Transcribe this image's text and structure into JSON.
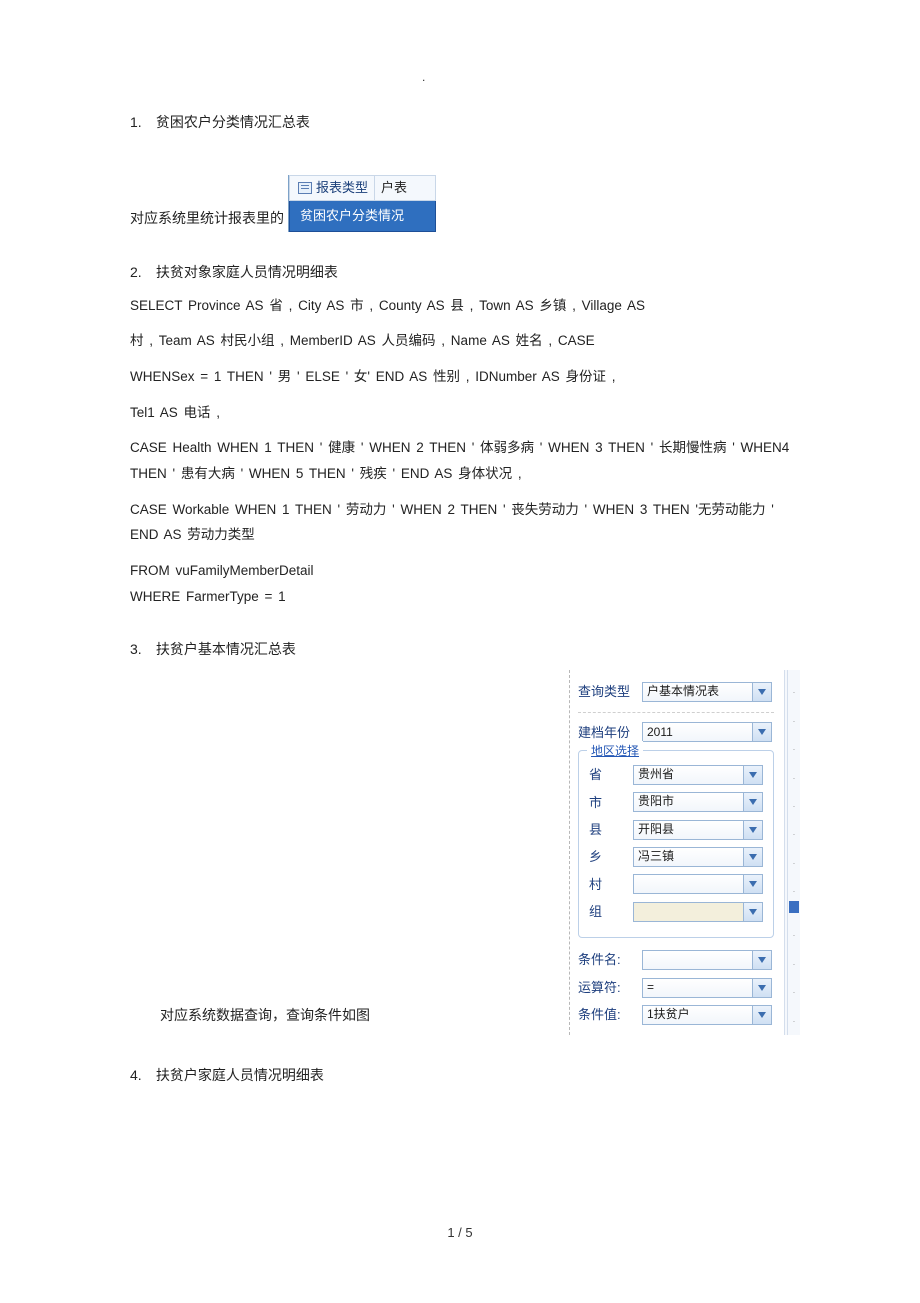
{
  "page_number": "1 / 5",
  "s1": {
    "num": "1.",
    "title": "贫困农户分类情况汇总表",
    "lead": "对应系统里统计报表里的",
    "panel": {
      "label": "报表类型",
      "value": "户表",
      "highlight": "贫困农户分类情况"
    }
  },
  "s2": {
    "num": "2.",
    "title": "扶贫对象家庭人员情况明细表",
    "sql_l1": "SELECT Province        AS 省 , City      AS   市 , County     AS 县 , Town     AS  乡镇 , Village         AS",
    "sql_l2": "村 , Team AS 村民小组 , MemberID AS 人员编码 , Name AS 姓名  , CASE",
    "sql_l3": "WHENSex = 1 THEN ' 男 ' ELSE ' 女' END AS 性别 , IDNumber AS 身份证 ,",
    "sql_l4": "Tel1   AS 电话 ,",
    "sql_l5": "CASE Health       WHEN 1   THEN  ' 健康 '     WHEN 2   THEN   ' 体弱多病  '    WHEN 3   THEN   ' 长期慢性病 '    WHEN4    THEN   ' 患有大病  ' WHEN 5     THEN  ' 残疾 ' END AS  身体状况   ,",
    "sql_l6": "CASE Workable        WHEN 1   THEN ' 劳动力 '    WHEN 2   THEN ' 丧失劳动力  '     WHEN 3   THEN  '无劳动能力  '    END  AS  劳动力类型",
    "sql_l7": "FROM vuFamilyMemberDetail",
    "sql_l8": "WHERE FarmerType       = 1"
  },
  "s3": {
    "num": "3.",
    "title": "扶贫户基本情况汇总表",
    "caption": "对应系统数据查询，查询条件如图",
    "panel": {
      "query_type_lbl": "查询类型",
      "query_type_val": "户基本情况表",
      "year_lbl": "建档年份",
      "year_val": "2011",
      "region_legend": "地区选择",
      "rows": [
        {
          "lbl": "省",
          "val": "贵州省"
        },
        {
          "lbl": "市",
          "val": "贵阳市"
        },
        {
          "lbl": "县",
          "val": "开阳县"
        },
        {
          "lbl": "乡",
          "val": "冯三镇"
        },
        {
          "lbl": "村",
          "val": ""
        },
        {
          "lbl": "组",
          "val": "",
          "disabled": true
        }
      ],
      "cond_name_lbl": "条件名:",
      "cond_name_val": "",
      "op_lbl": "运算符:",
      "op_val": "=",
      "cond_val_lbl": "条件值:",
      "cond_val_val": "1扶贫户"
    }
  },
  "s4": {
    "num": "4.",
    "title": "扶贫户家庭人员情况明细表"
  }
}
